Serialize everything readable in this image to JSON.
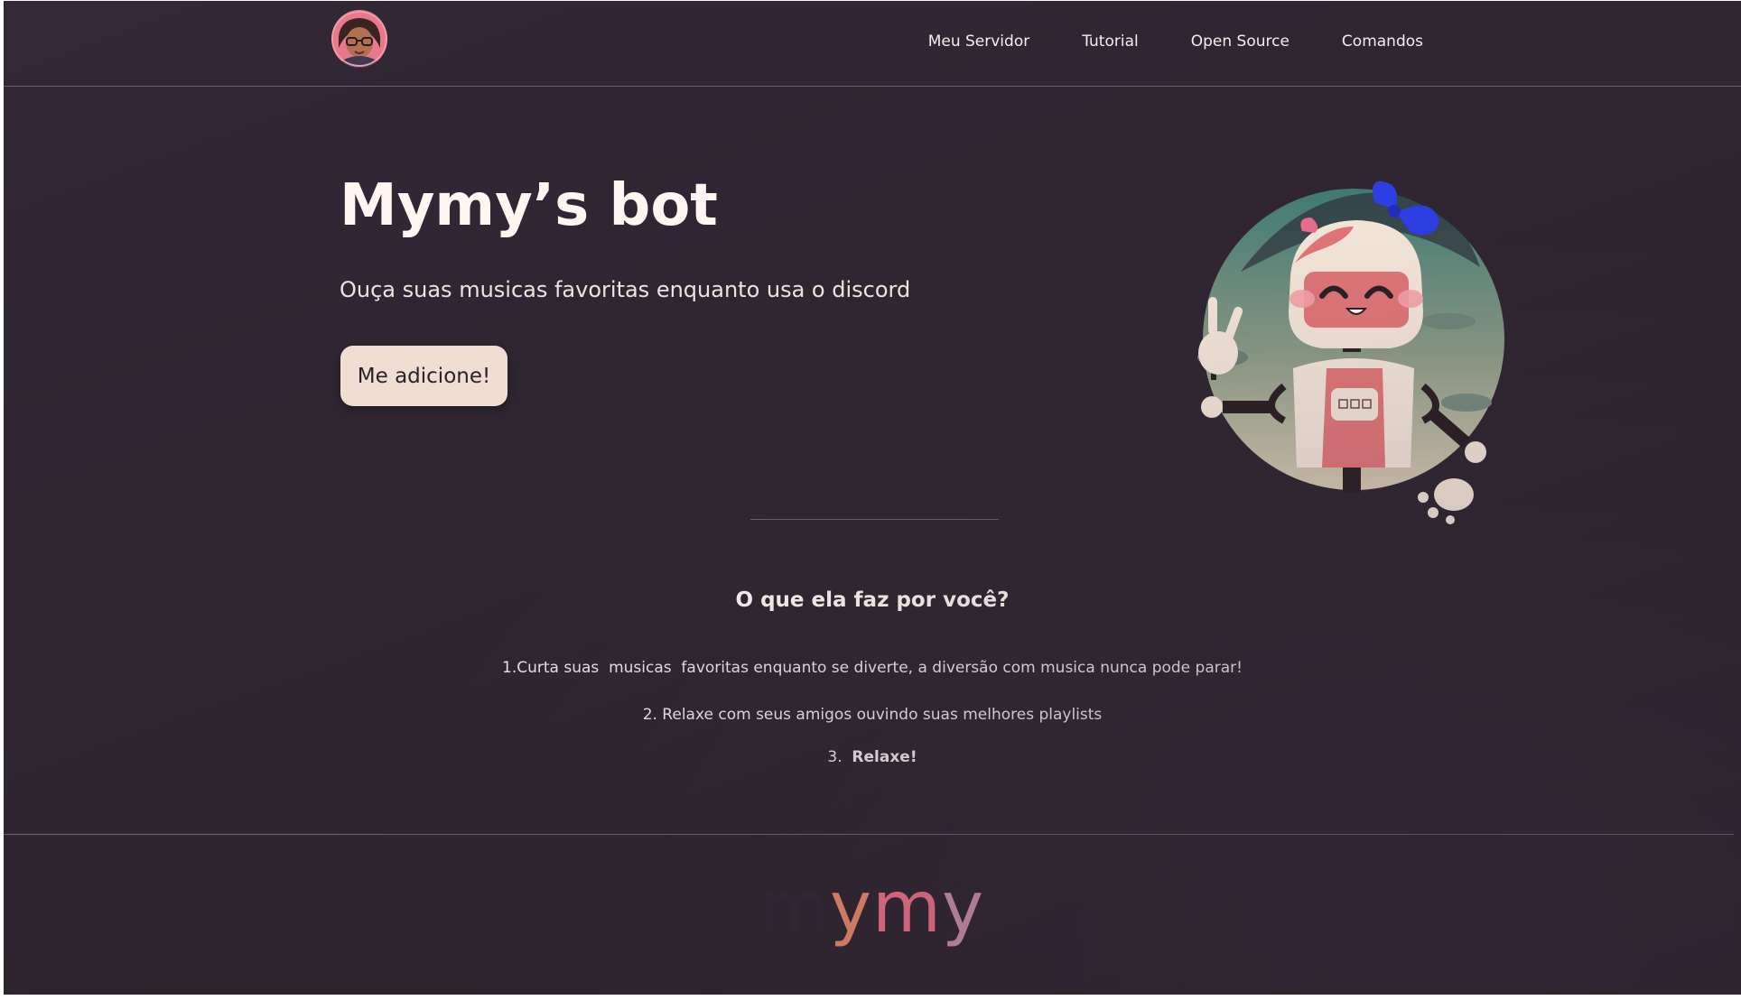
{
  "nav": {
    "items": [
      "Meu Servidor",
      "Tutorial",
      "Open Source",
      "Comandos"
    ]
  },
  "hero": {
    "title": "Mymy’s bot",
    "subtitle": "Ouça suas musicas favoritas enquanto usa o discord",
    "cta_label": "Me adicione!"
  },
  "features": {
    "title": "O que ela faz por você?",
    "item1": "1.Curta suas  musicas  favoritas enquanto se diverte, a diversão com musica nunca pode parar!",
    "item2": "2. Relaxe com seus amigos ouvindo suas melhores playlists",
    "item3_prefix": "3.  ",
    "item3_bold": "Relaxe!"
  },
  "footer": {
    "logo_letters": [
      "m",
      "y",
      "m",
      "y"
    ]
  },
  "colors": {
    "background": "#2e2530",
    "accent_pink": "#e56d85",
    "button": "#f1ddd2",
    "logo_gradient": [
      "#2f2433",
      "#e8886a",
      "#ec6f86",
      "#c98fa8"
    ]
  },
  "icons": {
    "avatar": "avatar-icon",
    "robot": "robot-illustration"
  }
}
